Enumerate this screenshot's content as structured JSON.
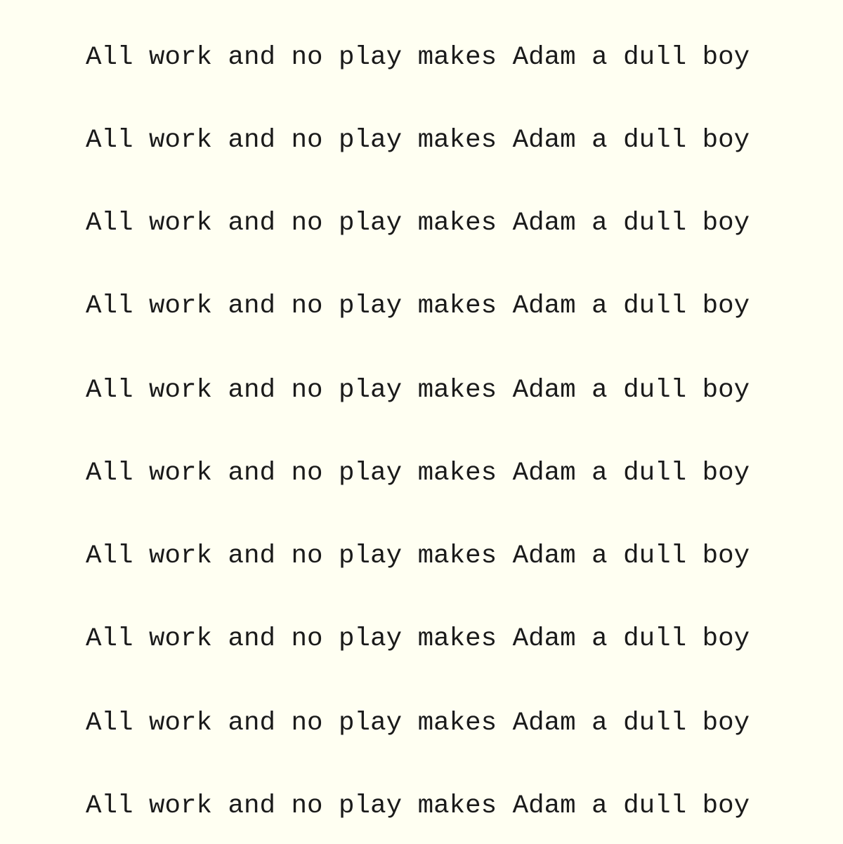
{
  "document": {
    "lines": [
      "All work and no play makes Adam a dull boy",
      "All work and no play makes Adam a dull boy",
      "All work and no play makes Adam a dull boy",
      "All work and no play makes Adam a dull boy",
      "All work and no play makes Adam a dull boy",
      "All work and no play makes Adam a dull boy",
      "All work and no play makes Adam a dull boy",
      "All work and no play makes Adam a dull boy",
      "All work and no play makes Adam a dull boy",
      "All work and no play makes Adam a dull boy"
    ]
  },
  "colors": {
    "background": "#fffff2",
    "text": "#1a1a1a"
  }
}
